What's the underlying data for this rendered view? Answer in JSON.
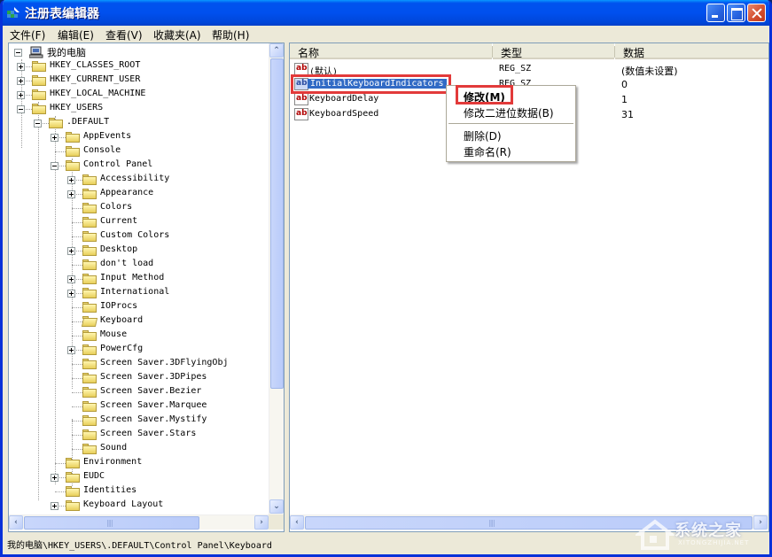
{
  "window": {
    "title": "注册表编辑器",
    "icon": "regedit-icon",
    "controls": [
      "minimize",
      "maximize",
      "close"
    ]
  },
  "menubar": {
    "items": [
      {
        "label": "文件(F)"
      },
      {
        "label": "编辑(E)"
      },
      {
        "label": "查看(V)"
      },
      {
        "label": "收藏夹(A)"
      },
      {
        "label": "帮助(H)"
      }
    ]
  },
  "tree": {
    "root": "我的电脑",
    "items": [
      {
        "label": "HKEY_CLASSES_ROOT",
        "expander": "plus"
      },
      {
        "label": "HKEY_CURRENT_USER",
        "expander": "plus"
      },
      {
        "label": "HKEY_LOCAL_MACHINE",
        "expander": "plus"
      },
      {
        "label": "HKEY_USERS",
        "expander": "minus"
      },
      {
        "label": ".DEFAULT",
        "expander": "minus"
      },
      {
        "label": "AppEvents",
        "expander": "plus"
      },
      {
        "label": "Console",
        "expander": "none"
      },
      {
        "label": "Control Panel",
        "expander": "minus"
      },
      {
        "label": "Accessibility",
        "expander": "plus"
      },
      {
        "label": "Appearance",
        "expander": "plus"
      },
      {
        "label": "Colors",
        "expander": "none"
      },
      {
        "label": "Current",
        "expander": "none"
      },
      {
        "label": "Custom Colors",
        "expander": "none"
      },
      {
        "label": "Desktop",
        "expander": "plus"
      },
      {
        "label": "don't load",
        "expander": "none"
      },
      {
        "label": "Input Method",
        "expander": "plus"
      },
      {
        "label": "International",
        "expander": "plus"
      },
      {
        "label": "IOProcs",
        "expander": "none"
      },
      {
        "label": "Keyboard",
        "expander": "none",
        "open": true
      },
      {
        "label": "Mouse",
        "expander": "none"
      },
      {
        "label": "PowerCfg",
        "expander": "plus"
      },
      {
        "label": "Screen Saver.3DFlyingObj",
        "expander": "none"
      },
      {
        "label": "Screen Saver.3DPipes",
        "expander": "none"
      },
      {
        "label": "Screen Saver.Bezier",
        "expander": "none"
      },
      {
        "label": "Screen Saver.Marquee",
        "expander": "none"
      },
      {
        "label": "Screen Saver.Mystify",
        "expander": "none"
      },
      {
        "label": "Screen Saver.Stars",
        "expander": "none"
      },
      {
        "label": "Sound",
        "expander": "none"
      },
      {
        "label": "Environment",
        "expander": "none"
      },
      {
        "label": "EUDC",
        "expander": "plus"
      },
      {
        "label": "Identities",
        "expander": "none"
      },
      {
        "label": "Keyboard Layout",
        "expander": "plus"
      }
    ]
  },
  "list": {
    "columns": [
      "名称",
      "类型",
      "数据"
    ],
    "rows": [
      {
        "name": "(默认)",
        "type": "REG_SZ",
        "data": "(数值未设置)"
      },
      {
        "name": "InitialKeyboardIndicators",
        "type": "REG_SZ",
        "data": "0",
        "selected": true
      },
      {
        "name": "KeyboardDelay",
        "type": "",
        "data": "1"
      },
      {
        "name": "KeyboardSpeed",
        "type": "",
        "data": "31"
      }
    ]
  },
  "context_menu": {
    "items": [
      {
        "label": "修改(M)",
        "default": true
      },
      {
        "label": "修改二进位数据(B)"
      },
      {
        "label": "删除(D)"
      },
      {
        "label": "重命名(R)"
      }
    ]
  },
  "statusbar": {
    "path": "我的电脑\\HKEY_USERS\\.DEFAULT\\Control Panel\\Keyboard"
  },
  "watermark": {
    "text": "系统之家",
    "sub": "XITONGZHIJIA.NET"
  }
}
